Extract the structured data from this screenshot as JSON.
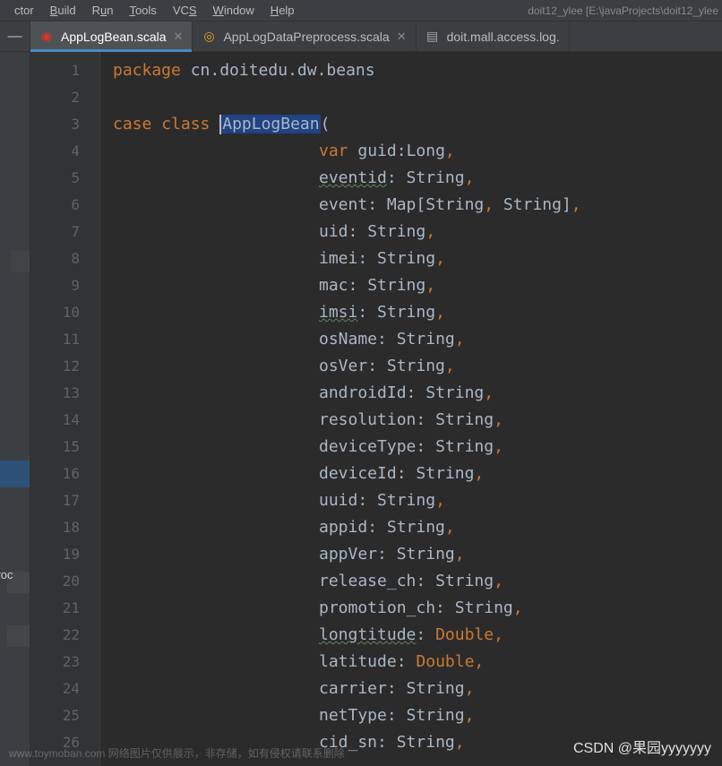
{
  "menubar": {
    "items": [
      "ctor",
      "Build",
      "Run",
      "Tools",
      "VCS",
      "Window",
      "Help"
    ],
    "underlines": [
      "",
      "B",
      "u",
      "T",
      "S",
      "W",
      "H"
    ]
  },
  "breadcrumb": "doit12_ylee [E:\\javaProjects\\doit12_ylee",
  "toolbar": {
    "collapse": "—"
  },
  "tabs": [
    {
      "label": "AppLogBean.scala",
      "icon": "scala-icon",
      "active": true,
      "closable": true
    },
    {
      "label": "AppLogDataPreprocess.scala",
      "icon": "scala-icon2",
      "active": false,
      "closable": true
    },
    {
      "label": "doit.mall.access.log.",
      "icon": "file-icon",
      "active": false,
      "closable": false
    }
  ],
  "sidebar_text": "eproc",
  "line_numbers": [
    "1",
    "2",
    "3",
    "4",
    "5",
    "6",
    "7",
    "8",
    "9",
    "10",
    "11",
    "12",
    "13",
    "14",
    "15",
    "16",
    "17",
    "18",
    "19",
    "20",
    "21",
    "22",
    "23",
    "24",
    "25",
    "26"
  ],
  "code": {
    "l1": {
      "kw": "package",
      "rest": " cn.doitedu.dw.beans"
    },
    "l3": {
      "kw1": "case",
      "kw2": "class",
      "name": "AppLogBean",
      "open": "("
    },
    "fields": [
      {
        "pre": "var ",
        "name": "guid",
        "colon": ":",
        "type": "Long",
        "comma": ","
      },
      {
        "pre": "",
        "name": "eventid",
        "colon": ": ",
        "type": "String",
        "comma": ",",
        "typo": true
      },
      {
        "pre": "",
        "name": "event",
        "colon": ": ",
        "type": "Map[String, String]",
        "comma": ","
      },
      {
        "pre": "",
        "name": "uid",
        "colon": ": ",
        "type": "String",
        "comma": ","
      },
      {
        "pre": "",
        "name": "imei",
        "colon": ": ",
        "type": "String",
        "comma": ","
      },
      {
        "pre": "",
        "name": "mac",
        "colon": ": ",
        "type": "String",
        "comma": ","
      },
      {
        "pre": "",
        "name": "imsi",
        "colon": ": ",
        "type": "String",
        "comma": ",",
        "typo": true
      },
      {
        "pre": "",
        "name": "osName",
        "colon": ": ",
        "type": "String",
        "comma": ","
      },
      {
        "pre": "",
        "name": "osVer",
        "colon": ": ",
        "type": "String",
        "comma": ","
      },
      {
        "pre": "",
        "name": "androidId",
        "colon": ": ",
        "type": "String",
        "comma": ","
      },
      {
        "pre": "",
        "name": "resolution",
        "colon": ": ",
        "type": "String",
        "comma": ","
      },
      {
        "pre": "",
        "name": "deviceType",
        "colon": ": ",
        "type": "String",
        "comma": ","
      },
      {
        "pre": "",
        "name": "deviceId",
        "colon": ": ",
        "type": "String",
        "comma": ","
      },
      {
        "pre": "",
        "name": "uuid",
        "colon": ": ",
        "type": "String",
        "comma": ","
      },
      {
        "pre": "",
        "name": "appid",
        "colon": ": ",
        "type": "String",
        "comma": ","
      },
      {
        "pre": "",
        "name": "appVer",
        "colon": ": ",
        "type": "String",
        "comma": ","
      },
      {
        "pre": "",
        "name": "release_ch",
        "colon": ": ",
        "type": "String",
        "comma": ","
      },
      {
        "pre": "",
        "name": "promotion_ch",
        "colon": ": ",
        "type": "String",
        "comma": ","
      },
      {
        "pre": "",
        "name": "longtitude",
        "colon": ": ",
        "type": "Double",
        "comma": ",",
        "typo": true,
        "doubletype": true
      },
      {
        "pre": "",
        "name": "latitude",
        "colon": ": ",
        "type": "Double",
        "comma": ",",
        "doubletype": true
      },
      {
        "pre": "",
        "name": "carrier",
        "colon": ": ",
        "type": "String",
        "comma": ","
      },
      {
        "pre": "",
        "name": "netType",
        "colon": ": ",
        "type": "String",
        "comma": ","
      },
      {
        "pre": "",
        "name": "cid_sn",
        "colon": ": ",
        "type": "String",
        "comma": ","
      }
    ]
  },
  "watermark_bl": "www.toymoban.com 网络图片仅供展示，非存储，如有侵权请联系删除",
  "watermark_br": "CSDN @果园yyyyyyy"
}
